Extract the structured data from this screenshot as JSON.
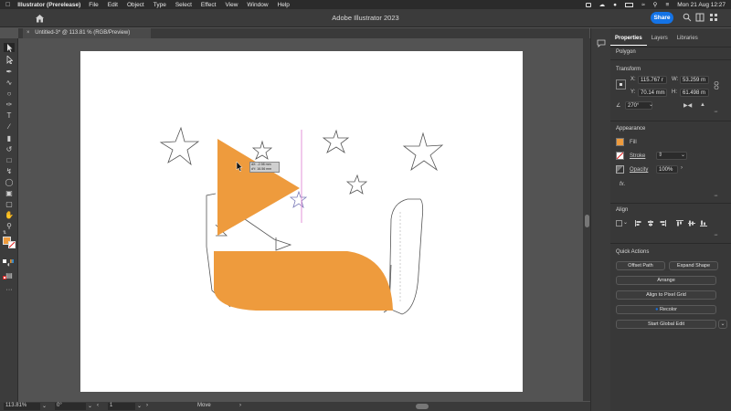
{
  "menubar": {
    "app_name": "Illustrator (Prerelease)",
    "items": [
      "File",
      "Edit",
      "Object",
      "Type",
      "Select",
      "Effect",
      "View",
      "Window",
      "Help"
    ],
    "datetime": "Mon 21 Aug  12:27"
  },
  "titlebar": {
    "title": "Adobe Illustrator 2023",
    "share_label": "Share"
  },
  "document": {
    "tab_label": "Untitled-3* @ 113.81 % (RGB/Preview)",
    "cursor_tooltip": [
      "dX: -2.98 mm",
      "dY: 16.56 mm"
    ]
  },
  "statusbar": {
    "zoom": "113.81%",
    "rotation": "0°",
    "artboard_number": "1",
    "tool_status": "Move"
  },
  "panel": {
    "tabs": [
      "Properties",
      "Layers",
      "Libraries"
    ],
    "selection_type": "Polygon",
    "transform": {
      "heading": "Transform",
      "x_label": "X:",
      "x_value": "115.767 r",
      "y_label": "Y:",
      "y_value": "70.14 mm",
      "w_label": "W:",
      "w_value": "53.259 m",
      "h_label": "H:",
      "h_value": "61.498 m",
      "rotate_value": "270°"
    },
    "appearance": {
      "heading": "Appearance",
      "fill_label": "Fill",
      "stroke_label": "Stroke",
      "opacity_label": "Opacity",
      "opacity_value": "100%",
      "fx_label": "fx."
    },
    "align": {
      "heading": "Align"
    },
    "quick_actions": {
      "heading": "Quick Actions",
      "offset_path": "Offset Path",
      "expand_shape": "Expand Shape",
      "arrange": "Arrange",
      "align_pixel_grid": "Align to Pixel Grid",
      "recolor": "Recolor",
      "start_global_edit": "Start Global Edit"
    }
  },
  "colors": {
    "fill_orange": "#ee9b3d",
    "share_blue": "#1473e6",
    "guide_magenta": "#d766c8"
  }
}
